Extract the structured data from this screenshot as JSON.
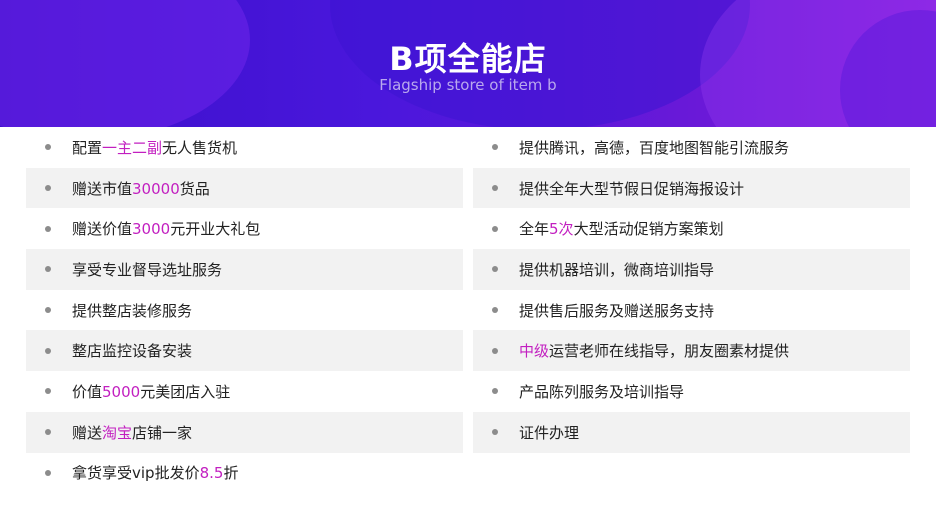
{
  "header": {
    "title": "B项全能店",
    "subtitle": "Flagship store of item b"
  },
  "colors": {
    "highlight": "#c21fc0",
    "header_gradient_start": "#3a0fc9",
    "header_gradient_end": "#8a1fe0",
    "row_shade": "#f2f2f2"
  },
  "left_items": [
    {
      "pre": "配置",
      "hl": "一主二副",
      "post": "无人售货机"
    },
    {
      "pre": "赠送市值",
      "hl": "30000",
      "post": "货品"
    },
    {
      "pre": "赠送价值",
      "hl": "3000",
      "post": "元开业大礼包"
    },
    {
      "pre": "享受专业督导选址服务",
      "hl": "",
      "post": ""
    },
    {
      "pre": "提供整店装修服务",
      "hl": "",
      "post": ""
    },
    {
      "pre": "整店监控设备安装",
      "hl": "",
      "post": ""
    },
    {
      "pre": "价值",
      "hl": "5000",
      "post": "元美团店入驻"
    },
    {
      "pre": "赠送",
      "hl": "淘宝",
      "post": "店铺一家"
    },
    {
      "pre": "拿货享受vip批发价",
      "hl": "8.5",
      "post": "折"
    }
  ],
  "right_items": [
    {
      "pre": "提供腾讯，高德，百度地图智能引流服务",
      "hl": "",
      "post": ""
    },
    {
      "pre": "提供全年大型节假日促销海报设计",
      "hl": "",
      "post": ""
    },
    {
      "pre": "全年",
      "hl": "5次",
      "post": "大型活动促销方案策划"
    },
    {
      "pre": "提供机器培训，微商培训指导",
      "hl": "",
      "post": ""
    },
    {
      "pre": "提供售后服务及赠送服务支持",
      "hl": "",
      "post": ""
    },
    {
      "pre": "",
      "hl": "中级",
      "post": "运营老师在线指导，朋友圈素材提供"
    },
    {
      "pre": "产品陈列服务及培训指导",
      "hl": "",
      "post": ""
    },
    {
      "pre": "证件办理",
      "hl": "",
      "post": ""
    }
  ]
}
